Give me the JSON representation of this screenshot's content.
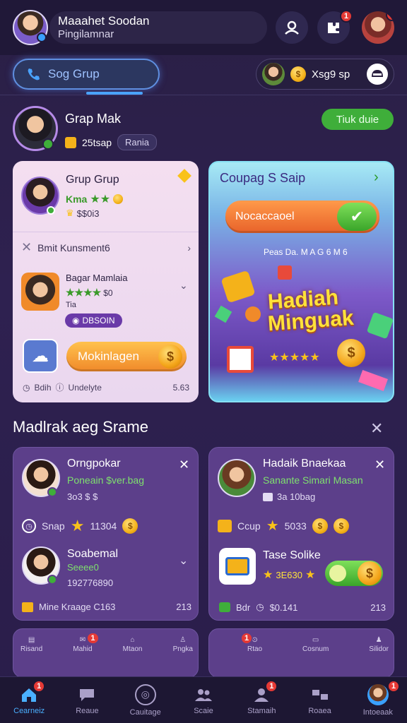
{
  "header": {
    "user_name": "Maaahet Soodan",
    "user_sub": "Pingilamnar",
    "notif_count_1": "1",
    "notif_count_2": "1"
  },
  "search": {
    "label": "Sog Grup"
  },
  "wallet": {
    "text": "Xsg9 sp"
  },
  "profile": {
    "name": "Grap Mak",
    "points": "25tsap",
    "tag": "Rania",
    "action_label": "Tiuk duie"
  },
  "card_left": {
    "title": "Grup Grup",
    "line1": "Kma",
    "line2": "$$0i3",
    "row_label": "Bmit Kunsment6",
    "user_name": "Bagar Mamlaia",
    "user_stars": "$0",
    "user_small": "Tia",
    "chip": "DBSOIN",
    "button_label": "Mokinlagen",
    "footer_left": "Bdih",
    "footer_mid": "Undelyte",
    "footer_right": "5.63"
  },
  "card_right": {
    "title": "Coupag S Saip",
    "button_label": "Nocaccaoel",
    "sub": "Peas Da. M A G 6 M 6",
    "promo_line1": "Hadiah",
    "promo_line2": "Minguak"
  },
  "section": {
    "title": "Madlrak aeg Srame"
  },
  "card_a": {
    "name": "Orngpokar",
    "sub": "Poneain $ver.bag",
    "small": "3o3 $ $",
    "stat_label": "Snap",
    "stat_value": "11304",
    "name2": "Soabemal",
    "sub2": "Seeee0",
    "small2": "192776890",
    "footer_label": "Mine Kraage C163",
    "footer_value": "213"
  },
  "card_b": {
    "name": "Hadaik Bnaekaa",
    "sub": "Sanante Simari Masan",
    "small": "3a 10bag",
    "stat_label": "Ccup",
    "stat_value": "5033",
    "name2": "Tase Solike",
    "sub2": "3E630",
    "footer_label": "Bdr",
    "footer_mid": "$0.141",
    "footer_value": "213"
  },
  "mini_left": {
    "tabs": [
      "Risand",
      "Mahid",
      "Mtaon",
      "Pngka"
    ]
  },
  "mini_right": {
    "tabs": [
      "Rtao",
      "Cosnum",
      "Silidor"
    ]
  },
  "nav": {
    "items": [
      "Cearneiz",
      "Reaue",
      "Cauitage",
      "Scaie",
      "Stamaih",
      "Roaea",
      "Intoeaak"
    ],
    "badge": "1"
  },
  "colors": {
    "accent_blue": "#4aa3ff",
    "accent_green": "#3fae3a",
    "accent_orange": "#f0892a",
    "badge_red": "#e53935"
  }
}
